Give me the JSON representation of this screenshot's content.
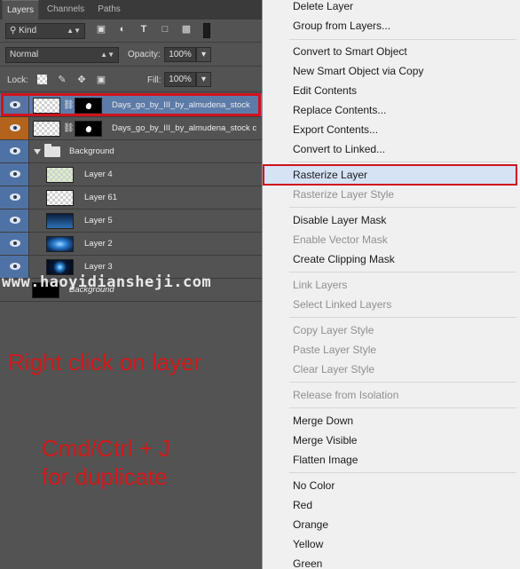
{
  "panel": {
    "tabs": [
      "Layers",
      "Channels",
      "Paths"
    ],
    "filter_kind": "Kind",
    "blend_mode": "Normal",
    "opacity_label": "Opacity:",
    "opacity_value": "100%",
    "lock_label": "Lock:",
    "fill_label": "Fill:",
    "fill_value": "100%",
    "filter_icons": [
      "image-filter-icon",
      "adjustment-filter-icon",
      "type-filter-icon",
      "shape-filter-icon",
      "smart-object-filter-icon"
    ],
    "lock_icons": [
      "lock-transparent-icon",
      "lock-paint-icon",
      "lock-position-icon",
      "lock-all-icon"
    ]
  },
  "layers": [
    {
      "name": "Days_go_by_III_by_almudena_stock",
      "selected": true
    },
    {
      "name": "Days_go_by_III_by_almudena_stock c"
    },
    {
      "name": "Background",
      "group": true
    },
    {
      "name": "Layer 4"
    },
    {
      "name": "Layer 61"
    },
    {
      "name": "Layer 5"
    },
    {
      "name": "Layer 2"
    },
    {
      "name": "Layer 3"
    },
    {
      "name": "Background"
    }
  ],
  "watermark": "www.haoyidiansheji.com",
  "annotations": {
    "right_click": "Right click on layer",
    "duplicate_line1": "Cmd/Ctrl + J",
    "duplicate_line2": "for duplicate"
  },
  "menu": {
    "items": [
      {
        "label": "Delete Layer",
        "enabled": true
      },
      {
        "label": "Group from Layers...",
        "enabled": true
      },
      {
        "label": "Convert to Smart Object",
        "enabled": true
      },
      {
        "label": "New Smart Object via Copy",
        "enabled": true
      },
      {
        "label": "Edit Contents",
        "enabled": true
      },
      {
        "label": "Replace Contents...",
        "enabled": true
      },
      {
        "label": "Export Contents...",
        "enabled": true
      },
      {
        "label": "Convert to Linked...",
        "enabled": true
      },
      {
        "label": "Rasterize Layer",
        "enabled": true,
        "highlighted": true
      },
      {
        "label": "Rasterize Layer Style",
        "enabled": false
      },
      {
        "label": "Disable Layer Mask",
        "enabled": true
      },
      {
        "label": "Enable Vector Mask",
        "enabled": false
      },
      {
        "label": "Create Clipping Mask",
        "enabled": true
      },
      {
        "label": "Link Layers",
        "enabled": false
      },
      {
        "label": "Select Linked Layers",
        "enabled": false
      },
      {
        "label": "Copy Layer Style",
        "enabled": false
      },
      {
        "label": "Paste Layer Style",
        "enabled": false
      },
      {
        "label": "Clear Layer Style",
        "enabled": false
      },
      {
        "label": "Release from Isolation",
        "enabled": false
      },
      {
        "label": "Merge Down",
        "enabled": true
      },
      {
        "label": "Merge Visible",
        "enabled": true
      },
      {
        "label": "Flatten Image",
        "enabled": true
      },
      {
        "label": "No Color",
        "enabled": true
      },
      {
        "label": "Red",
        "enabled": true
      },
      {
        "label": "Orange",
        "enabled": true
      },
      {
        "label": "Yellow",
        "enabled": true
      },
      {
        "label": "Green",
        "enabled": true
      }
    ]
  },
  "colors": {
    "highlight_border": "#d0131e",
    "selected_layer": "#5d7ba9",
    "annotation_text": "#cf1a1a"
  }
}
